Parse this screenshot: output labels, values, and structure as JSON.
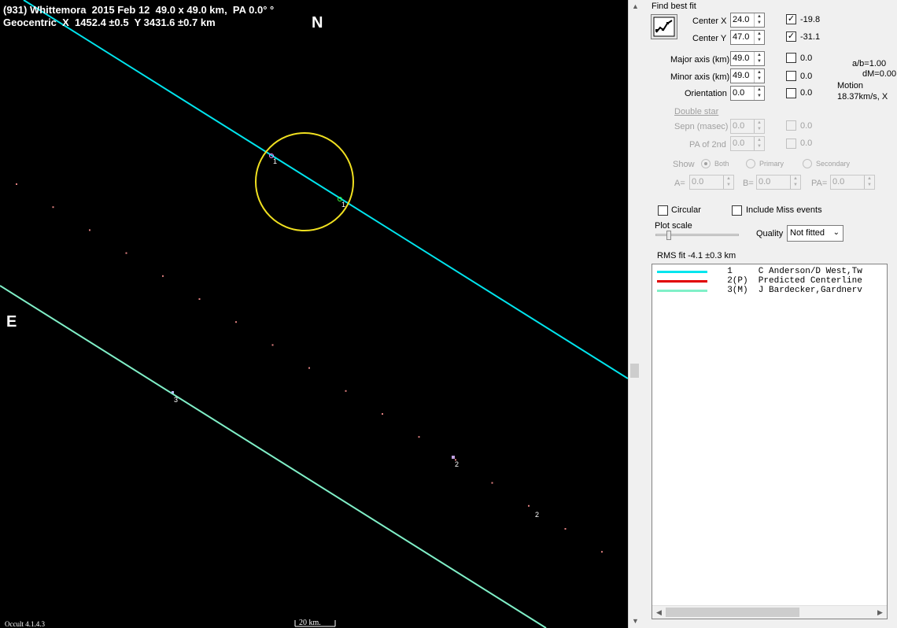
{
  "plot": {
    "title_line1": "(931) Whittemora  2015 Feb 12  49.0 x 49.0 km,  PA 0.0° °",
    "title_line2": "Geocentric  X  1452.4 ±0.5  Y 3431.6 ±0.7 km",
    "north_label": "N",
    "east_label": "E",
    "version": "Occult 4.1.4.3",
    "scale_label": "20 km.",
    "chord_labels": {
      "chord1_a": "1",
      "chord1_b": "1",
      "chord3": "3",
      "chord2_a": "2",
      "chord2_b": "2"
    },
    "colors": {
      "chord1": "#00e5ee",
      "chord3": "#80f0c8",
      "ellipse": "#f0e020",
      "predicted_dots": "#e08080",
      "background": "#000000"
    }
  },
  "panel": {
    "find_best_fit": "Find best fit",
    "fit_button_icon": "chart-fit-icon",
    "center_x": {
      "label": "Center X",
      "value": "24.0",
      "checked": true,
      "result": "-19.8"
    },
    "center_y": {
      "label": "Center Y",
      "value": "47.0",
      "checked": true,
      "result": "-31.1"
    },
    "major_axis": {
      "label": "Major axis (km)",
      "value": "49.0",
      "checked": false,
      "result": "0.0"
    },
    "minor_axis": {
      "label": "Minor axis (km)",
      "value": "49.0",
      "checked": false,
      "result": "0.0"
    },
    "orientation": {
      "label": "Orientation",
      "value": "0.0",
      "checked": false,
      "result": "0.0"
    },
    "ratio_ab": "a/b=1.00",
    "dm": "dM=0.00",
    "motion_label": "Motion",
    "motion_value": "18.37km/s, X",
    "double_star": "Double star",
    "sepn": {
      "label": "Sepn (masec)",
      "value": "0.0",
      "result": "0.0"
    },
    "pa2": {
      "label": "PA of 2nd",
      "value": "0.0",
      "result": "0.0"
    },
    "show_label": "Show",
    "show_both": "Both",
    "show_primary": "Primary",
    "show_secondary": "Secondary",
    "a_label": "A=",
    "a_value": "0.0",
    "b_label": "B=",
    "b_value": "0.0",
    "pa_label": "PA=",
    "pa_value": "0.0",
    "circular": "Circular",
    "include_miss": "Include Miss events",
    "plot_scale": "Plot scale",
    "quality_label": "Quality",
    "quality_value": "Not fitted",
    "rms_fit": "RMS fit  -4.1 ±0.3 km",
    "legend": [
      {
        "text": "  1     C Anderson/D West,Tw",
        "color": "#00e5ee"
      },
      {
        "text": "  2(P)  Predicted Centerline",
        "color": "#e00000"
      },
      {
        "text": "  3(M)  J Bardecker,Gardnerv",
        "color": "#80f0c8"
      }
    ]
  }
}
